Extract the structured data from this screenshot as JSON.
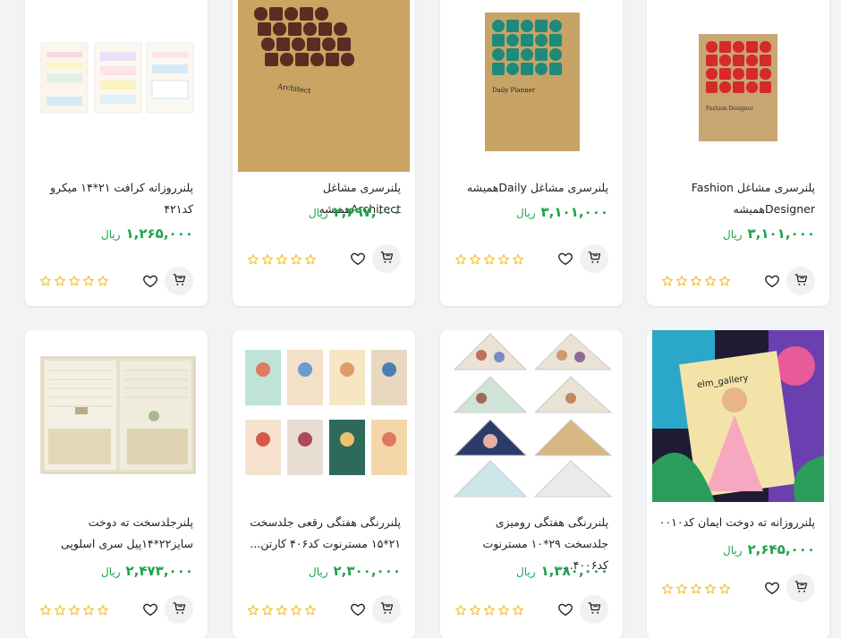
{
  "products": [
    {
      "title": "پلنرسری مشاغل Fashion Designerهمیشه",
      "price": "۳,۱۰۱,۰۰۰",
      "currency": "ریال",
      "cover_text": "Fashion Designer"
    },
    {
      "title": "پلنرسری مشاغل Dailyهمیشه",
      "price": "۳,۱۰۱,۰۰۰",
      "currency": "ریال",
      "cover_text": "Daily Planner"
    },
    {
      "title": "پلنرسری مشاغل Architectهمیشه",
      "price": "۲,۶۹۷,۰۰۰",
      "currency": "ریال",
      "cover_text": "Architect"
    },
    {
      "title": "پلنرروزانه کرافت ۲۱*۱۴ میکرو کد۴۲۱",
      "price": "۱,۲۶۵,۰۰۰",
      "currency": "ریال"
    },
    {
      "title": "پلنرروزانه ته دوخت ایمان کد۰۰۱۰",
      "price": "۲,۶۴۵,۰۰۰",
      "currency": "ریال",
      "cover_text": "elm_gallery"
    },
    {
      "title": "پلنررنگی هفتگی رومیزی جلدسخت ۲۹*۱۰ مسترنوت کد۴۰۰۶...",
      "price": "۱,۳۸۰,۰۰۰",
      "currency": "ریال"
    },
    {
      "title": "پلنررنگی هفتگی رقعی جلدسخت ۲۱*۱۵ مسترنوت کد۴۰۶ کارتن...",
      "price": "۲,۳۰۰,۰۰۰",
      "currency": "ریال"
    },
    {
      "title": "پلنرجلدسخت ته دوخت سایز۲۲*۱۴پیل سری اسلوپی",
      "price": "۲,۴۷۳,۰۰۰",
      "currency": "ریال"
    }
  ],
  "colors": {
    "price": "#1aa34a",
    "star": "#f2c230",
    "kraft": "#c9a15a"
  },
  "icons": {
    "rating": "star-outline-icon",
    "wishlist": "heart-icon",
    "cart": "cart-icon"
  }
}
